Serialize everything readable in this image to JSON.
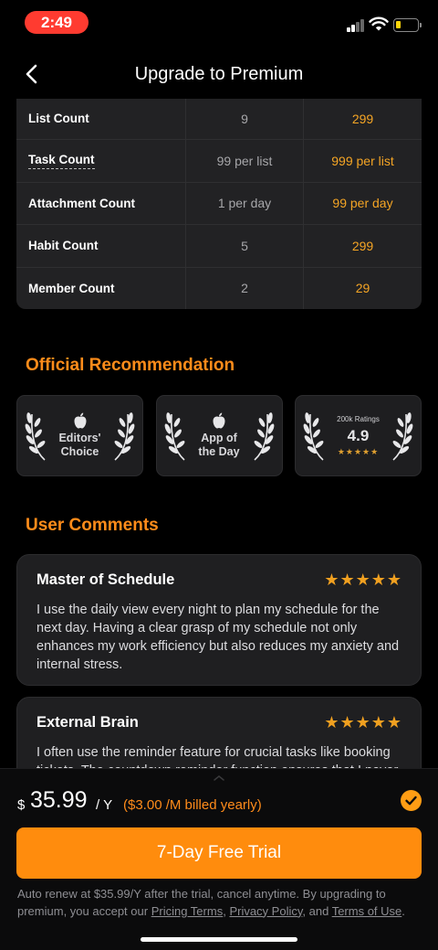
{
  "status_bar": {
    "time": "2:49"
  },
  "nav": {
    "title": "Upgrade to Premium"
  },
  "comparison": {
    "rows": [
      {
        "name": "List Count",
        "free": "9",
        "premium": "299",
        "dotted": false
      },
      {
        "name": "Task Count",
        "free": "99 per list",
        "premium": "999 per list",
        "dotted": true
      },
      {
        "name": "Attachment Count",
        "free": "1 per day",
        "premium": "99 per day",
        "dotted": false
      },
      {
        "name": "Habit Count",
        "free": "5",
        "premium": "299",
        "dotted": false
      },
      {
        "name": "Member Count",
        "free": "2",
        "premium": "29",
        "dotted": false
      }
    ]
  },
  "recommendation": {
    "title": "Official Recommendation",
    "badges": {
      "editors": {
        "line1": "Editors'",
        "line2": "Choice"
      },
      "app_of_day": {
        "line1": "App of",
        "line2": "the Day"
      },
      "ratings": {
        "label": "200k Ratings",
        "value": "4.9",
        "stars": "★★★★★"
      }
    }
  },
  "comments": {
    "title": "User Comments",
    "items": [
      {
        "title": "Master of Schedule",
        "stars": "★★★★★",
        "body": "I use the daily view every night to plan my schedule for the next day. Having a clear grasp of my schedule not only enhances my work efficiency but also reduces my anxiety and internal stress."
      },
      {
        "title": "External Brain",
        "stars": "★★★★★",
        "body": "I often use the reminder feature for crucial tasks like booking tickets. The countdown reminder function ensures that I never miss"
      }
    ]
  },
  "purchase": {
    "currency": "$",
    "amount": "35.99",
    "period": "/ Y",
    "note": "($3.00 /M billed yearly)",
    "button_label": "7-Day Free Trial",
    "legal": {
      "prefix": "Auto renew at $35.99/Y after the trial, cancel anytime. By upgrading to premium, you accept our ",
      "pricing_terms": "Pricing Terms",
      "sep1": ", ",
      "privacy_policy": "Privacy Policy",
      "sep2": ", and ",
      "terms_of_use": "Terms of Use",
      "suffix": "."
    }
  },
  "colors": {
    "accent": "#ff8c0d",
    "premium_value": "#f5a524",
    "time_pill": "#ff3b30"
  }
}
